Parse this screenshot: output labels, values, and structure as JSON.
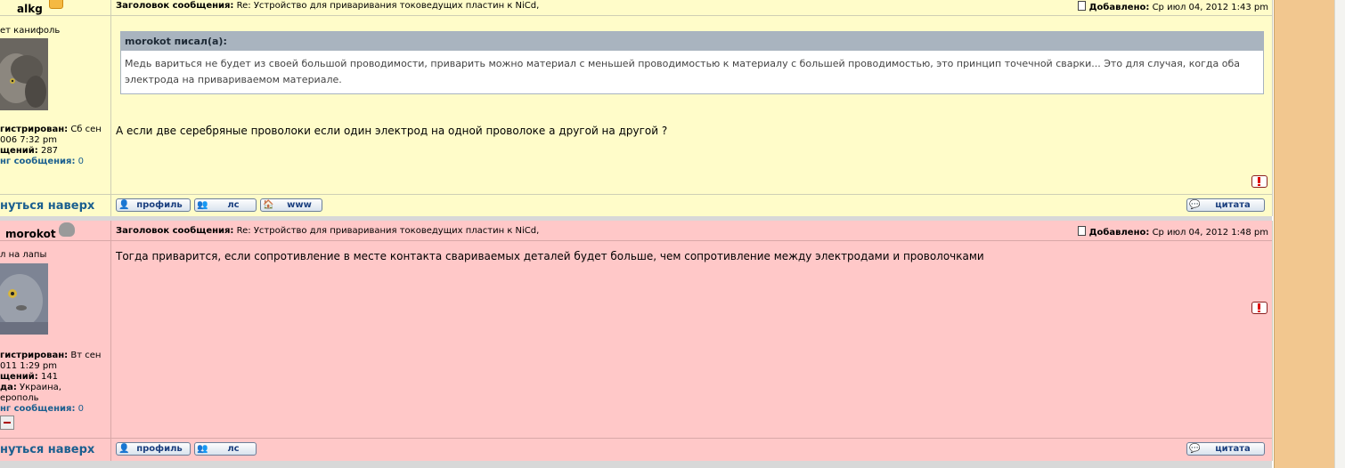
{
  "posts": [
    {
      "author": "alkg",
      "rank": "ет канифоль",
      "registered_label": "гистрирован:",
      "registered_value": "Сб сен",
      "registered_line2": "006 7:32 pm",
      "messages_label": "щений:",
      "messages_value": "287",
      "rating_label": "нг сообщения:",
      "rating_value": "0",
      "back_to_top": "нуться наверх",
      "subject_label": "Заголовок сообщения:",
      "subject_value": "Re: Устройство для приваривания токоведущих пластин к NiCd,",
      "added_label": "Добавлено:",
      "added_value": "Ср июл 04, 2012 1:43 pm",
      "quote_author": "morokot писал(а):",
      "quote_text": "Медь вариться не будет из своей большой проводимости, приварить можно материал с меньшей проводимостью к материалу с большей проводимостью, это принцип точечной сварки... Это для случая, когда оба электрода на привариваемом материале.",
      "message": "А если две серебряные проволоки если один электрод на одной проволоке а другой на другой ?",
      "buttons": [
        "профиль",
        "лс",
        "www"
      ],
      "quote_button": "цитата"
    },
    {
      "author": "morokot",
      "rank": "л на лапы",
      "registered_label": "гистрирован:",
      "registered_value": "Вт сен",
      "registered_line2": "011 1:29 pm",
      "messages_label": "щений:",
      "messages_value": "141",
      "location_label": "да:",
      "location_value": "Украина,",
      "location_line2": "ерополь",
      "rating_label": "нг сообщения:",
      "rating_value": "0",
      "back_to_top": "нуться наверх",
      "subject_label": "Заголовок сообщения:",
      "subject_value": "Re: Устройство для приваривания токоведущих пластин к NiCd,",
      "added_label": "Добавлено:",
      "added_value": "Ср июл 04, 2012 1:48 pm",
      "message": "Тогда приварится, если сопротивление в месте контакта свариваемых деталей будет больше, чем сопротивление между электродами и проволочками",
      "buttons": [
        "профиль",
        "лс"
      ],
      "quote_button": "цитата"
    }
  ]
}
